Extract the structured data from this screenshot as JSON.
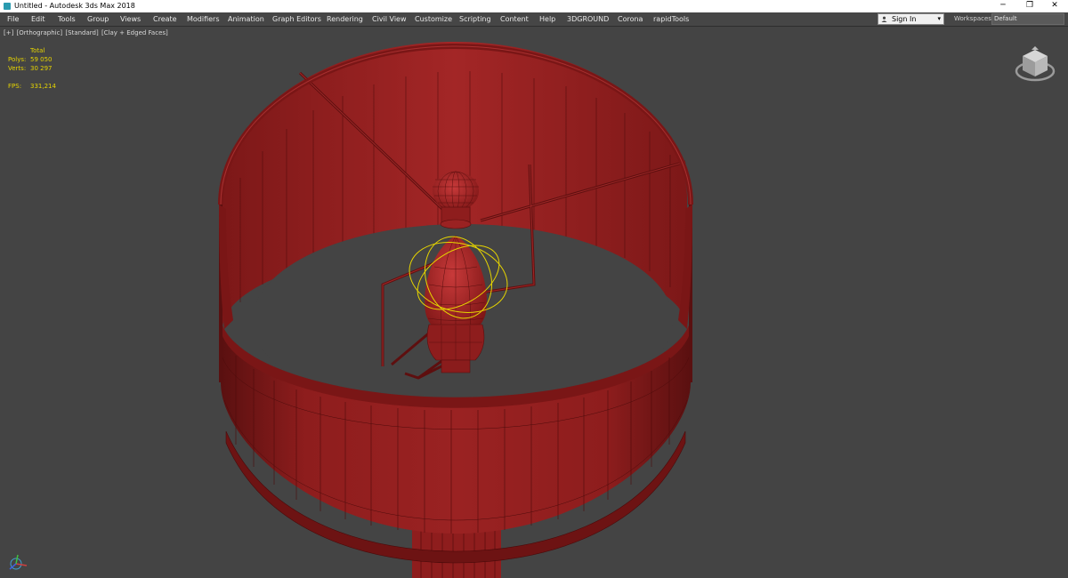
{
  "window": {
    "title": "Untitled - Autodesk 3ds Max 2018",
    "minimize_glyph": "─",
    "maximize_glyph": "❐",
    "close_glyph": "✕"
  },
  "menu": {
    "items": [
      "File",
      "Edit",
      "Tools",
      "Group",
      "Views",
      "Create",
      "Modifiers",
      "Animation",
      "Graph Editors",
      "Rendering",
      "Civil View",
      "Customize",
      "Scripting",
      "Content",
      "Help",
      "3DGROUND",
      "Corona",
      "rapidTools"
    ]
  },
  "account": {
    "signin_label": "Sign In",
    "caret": "▾"
  },
  "workspace": {
    "label": "Workspaces:",
    "value": "Default"
  },
  "viewport": {
    "label_plus": "[+]",
    "label_view": "[Orthographic]",
    "label_shading": "[Standard]",
    "label_mode": "[Clay + Edged Faces]"
  },
  "stats": {
    "header": "Total",
    "polys_label": "Polys:",
    "polys_value": "59 050",
    "verts_label": "Verts:",
    "verts_value": "30 297",
    "fps_label": "FPS:",
    "fps_value": "331,214"
  },
  "icons": {
    "app": "3ds-max-app-icon",
    "viewcube": "viewcube-icon",
    "axis": "axis-tripod-icon",
    "user": "user-icon"
  },
  "colors": {
    "viewport_bg": "#444444",
    "model_red": "#8c1b1b",
    "wire": "#5c0d0d",
    "selection_gizmo": "#e6d400",
    "stats_text": "#e6d400"
  }
}
